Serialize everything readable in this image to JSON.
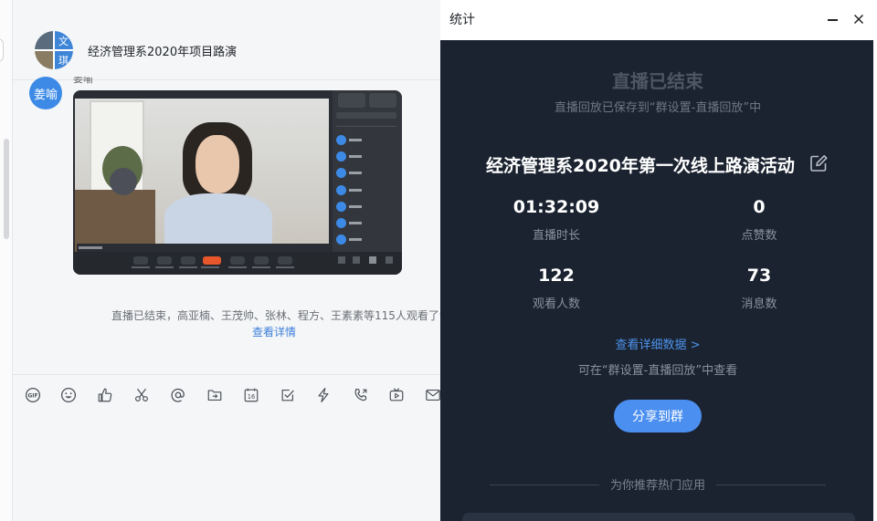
{
  "chat": {
    "group_avatar_chars": [
      "文",
      "瑜",
      "",
      "琪"
    ],
    "group_title": "经济管理系2020年项目路演",
    "sender_avatar_text": "姜喻",
    "sender_name": "姜喻",
    "system_message": "直播已结束，高亚楠、王茂帅、张林、程方、王素素等115人观看了该直",
    "detail_link": "查看详情",
    "toolbar_icons": [
      "gif-icon",
      "emoji-icon",
      "thumbs-up-icon",
      "scissors-icon",
      "at-icon",
      "folder-icon",
      "calendar-icon",
      "checkbox-icon",
      "lightning-icon",
      "phone-icon",
      "tv-icon",
      "mail-icon"
    ],
    "calendar_day": "16"
  },
  "stats": {
    "window_title": "统计",
    "status_title": "直播已结束",
    "saved_note": "直播回放已保存到“群设置-直播回放”中",
    "event_title": "经济管理系2020年第一次线上路演活动",
    "items": [
      {
        "value": "01:32:09",
        "label": "直播时长"
      },
      {
        "value": "0",
        "label": "点赞数"
      },
      {
        "value": "122",
        "label": "观看人数"
      },
      {
        "value": "73",
        "label": "消息数"
      }
    ],
    "more_data_link": "查看详细数据 >",
    "find_note": "可在“群设置-直播回放”中查看",
    "share_button": "分享到群",
    "recommend_label": "为你推荐热门应用"
  }
}
